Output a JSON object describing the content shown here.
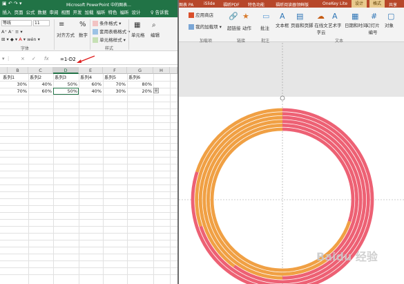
{
  "excel": {
    "title": "Microsoft PowerPoint 中的图表...",
    "tabs": [
      "插入",
      "页面",
      "公式",
      "数据",
      "审阅",
      "视图",
      "开发",
      "加载",
      "福昕",
      "特色",
      "福昕",
      "设计"
    ],
    "active_tab": "开始",
    "ribbon": {
      "font_name": "等线",
      "font_size": "11",
      "align_label": "对齐方式",
      "number_label": "数字",
      "cond_format": "条件格式",
      "table_format": "套用表格格式",
      "cell_style": "单元格样式",
      "cells_label": "单元格",
      "edit_label": "编辑",
      "font_group": "字体",
      "style_group": "样式",
      "percent_symbol": "%"
    },
    "formula": {
      "cancel": "×",
      "confirm": "✓",
      "fx": "fx",
      "value": "=1-D2"
    },
    "columns": [
      "B",
      "C",
      "D",
      "E",
      "F",
      "G",
      "H"
    ],
    "selected_column": "D",
    "rows": [
      [
        "系列1",
        "系列2",
        "系列3",
        "系列4",
        "系列5",
        "系列6"
      ],
      [
        "30%",
        "40%",
        "50%",
        "60%",
        "70%",
        "80%"
      ],
      [
        "70%",
        "60%",
        "50%",
        "40%",
        "30%",
        "20%"
      ]
    ]
  },
  "ppt": {
    "tabs": [
      "图表 PA",
      "iSlide",
      "福昕PDF",
      "特色功能",
      "福昕阅读器领鲜版",
      "OneKey Lite",
      "设计",
      "格式"
    ],
    "share": "共享",
    "ribbon": {
      "app_store": "应用商店",
      "my_addins": "我的加载项",
      "hyperlink": "超链接",
      "action": "动作",
      "comment": "批注",
      "textbox": "文本框",
      "header_footer": "页眉和页脚",
      "online_text": "在线文字云",
      "wordart": "艺术字",
      "date_time": "日期和时间",
      "slide_number": "幻灯片编号",
      "object": "对象",
      "groups": [
        "加载项",
        "链接",
        "批注",
        "文本"
      ]
    },
    "chart_data": {
      "type": "pie",
      "subtype": "doughnut",
      "colors": {
        "primary": "#ED6174",
        "secondary": "#F0A044"
      },
      "series": [
        {
          "values": [
            30,
            70
          ]
        },
        {
          "values": [
            40,
            60
          ]
        },
        {
          "values": [
            50,
            50
          ]
        },
        {
          "values": [
            60,
            40
          ]
        },
        {
          "values": [
            70,
            30
          ]
        },
        {
          "values": [
            80,
            20
          ]
        }
      ]
    }
  },
  "watermark": "Baidu 经验"
}
